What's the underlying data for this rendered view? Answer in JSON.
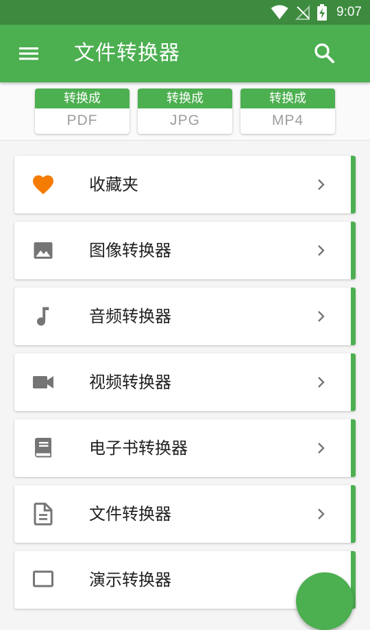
{
  "status_bar": {
    "time": "9:07"
  },
  "app_bar": {
    "title": "文件转换器"
  },
  "chips": [
    {
      "top": "转换成",
      "format": "PDF"
    },
    {
      "top": "转换成",
      "format": "JPG"
    },
    {
      "top": "转换成",
      "format": "MP4"
    }
  ],
  "items": [
    {
      "label": "收藏夹",
      "icon": "heart-icon"
    },
    {
      "label": "图像转换器",
      "icon": "image-icon"
    },
    {
      "label": "音频转换器",
      "icon": "music-note-icon"
    },
    {
      "label": "视频转换器",
      "icon": "videocam-icon"
    },
    {
      "label": "电子书转换器",
      "icon": "book-icon"
    },
    {
      "label": "文件转换器",
      "icon": "document-icon"
    },
    {
      "label": "演示转换器",
      "icon": "presentation-icon"
    }
  ],
  "colors": {
    "primary": "#4caf50",
    "primary_dark": "#3d8b3f",
    "heart": "#f57c00",
    "icon_grey": "#757575"
  }
}
